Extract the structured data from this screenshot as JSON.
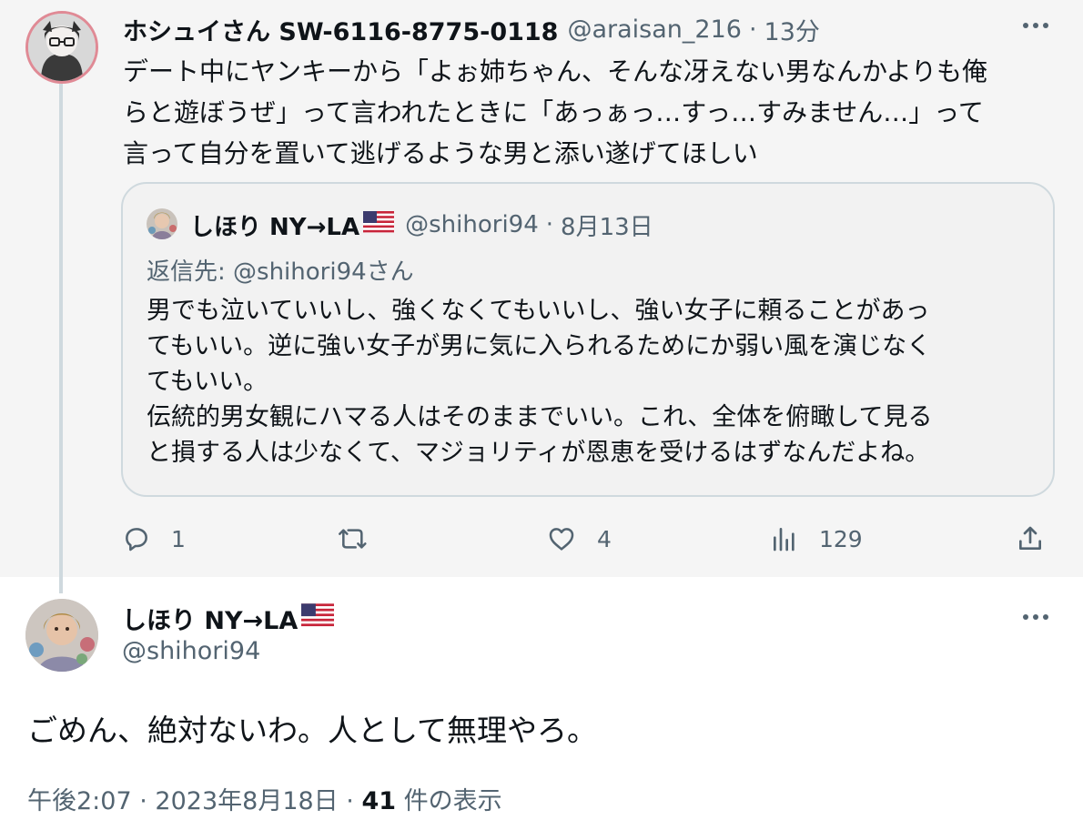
{
  "parent_tweet": {
    "author_name": "ホシュイさん SW-6116-8775-0118",
    "handle": "@araisan_216",
    "separator": "·",
    "time": "13分",
    "text": "デート中にヤンキーから「よぉ姉ちゃん、そんな冴えない男なんかよりも俺\nらと遊ぼうぜ」って言われたときに「あっぁっ…すっ…すみません…」って\n言って自分を置いて逃げるような男と添い遂げてほしい",
    "quoted": {
      "author_name": "しほり NY→LA",
      "handle": "@shihori94",
      "separator": "·",
      "date": "8月13日",
      "reply_to_label": "返信先: @shihori94さん",
      "text": "男でも泣いていいし、強くなくてもいいし、強い女子に頼ることがあっ\nてもいい。逆に強い女子が男に気に入られるためにか弱い風を演じなく\nてもいい。\n伝統的男女観にハマる人はそのままでいい。これ、全体を俯瞰して見る\nと損する人は少なくて、マジョリティが恩恵を受けるはずなんだよね。"
    },
    "actions": {
      "replies": "1",
      "retweets": "",
      "likes": "4",
      "views": "129"
    }
  },
  "current_tweet": {
    "author_name": "しほり NY→LA",
    "handle": "@shihori94",
    "text": "ごめん、絶対ないわ。人として無理やろ。",
    "time": "午後2:07",
    "separator": "·",
    "date": "2023年8月18日",
    "views_count": "41",
    "views_label": "件の表示"
  },
  "icons": {
    "reply": "reply-icon",
    "retweet": "retweet-icon",
    "like": "heart-icon",
    "views": "views-icon",
    "share": "share-icon",
    "more": "more-icon",
    "flag": "us-flag-icon"
  },
  "colors": {
    "text": "#0f1419",
    "secondary": "#536471",
    "parent_background": "#f5f5f5",
    "border": "#cfd9de"
  }
}
